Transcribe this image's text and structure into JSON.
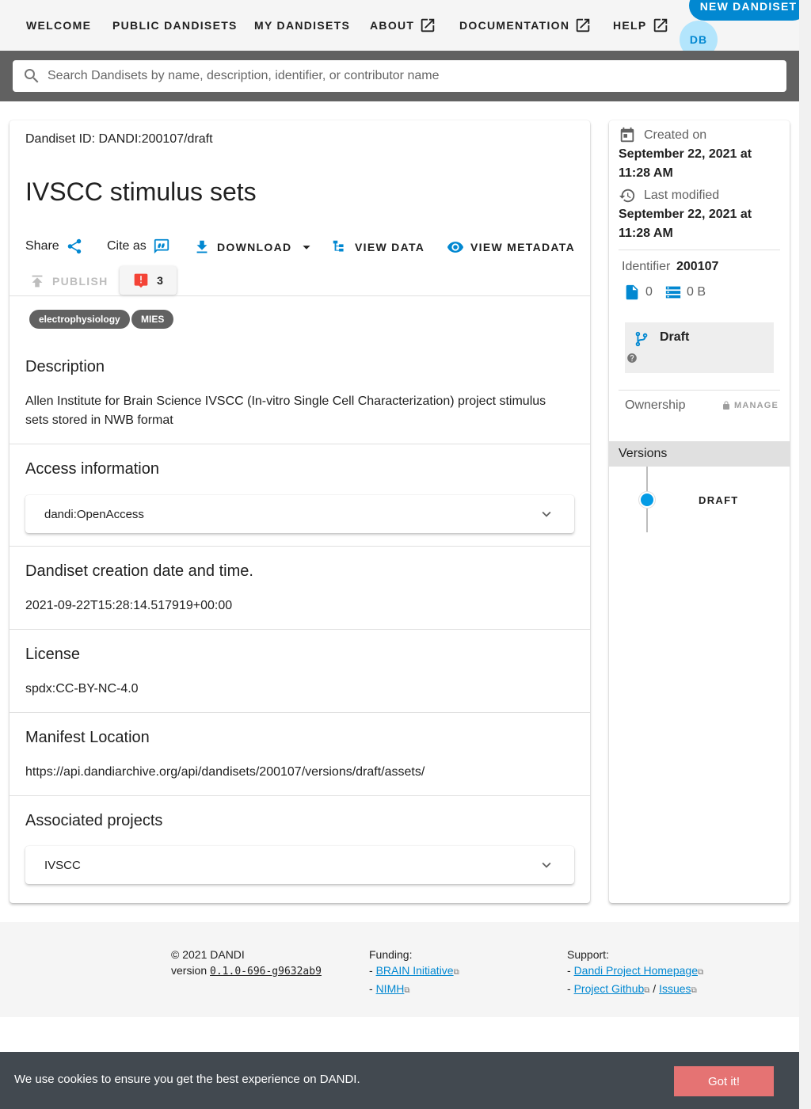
{
  "nav": {
    "items": [
      {
        "label": "Welcome",
        "external": false
      },
      {
        "label": "Public Dandisets",
        "external": false
      },
      {
        "label": "My Dandisets",
        "external": false
      },
      {
        "label": "About",
        "external": true
      },
      {
        "label": "Documentation",
        "external": true
      },
      {
        "label": "Help",
        "external": true
      }
    ],
    "new_dandiset_label": "New Dandiset",
    "avatar_initials": "DB"
  },
  "search": {
    "placeholder": "Search Dandisets by name, description, identifier, or contributor name",
    "value": ""
  },
  "dandiset": {
    "id_line": "Dandiset ID: DANDI:200107/draft",
    "title": "IVSCC stimulus sets",
    "actions": {
      "share": "Share",
      "cite": "Cite as",
      "download": "Download",
      "view_data": "View Data",
      "view_metadata": "View Metadata",
      "publish": "Publish",
      "error_count": "3"
    },
    "keywords": [
      "electrophysiology",
      "MIES"
    ],
    "sections": {
      "description_title": "Description",
      "description_text": "Allen Institute for Brain Science IVSCC (In-vitro Single Cell Characterization) project stimulus sets stored in NWB format",
      "access_title": "Access information",
      "access_value": "dandi:OpenAccess",
      "created_title": "Dandiset creation date and time.",
      "created_value": "2021-09-22T15:28:14.517919+00:00",
      "license_title": "License",
      "license_value": "spdx:CC-BY-NC-4.0",
      "manifest_title": "Manifest Location",
      "manifest_value": "https://api.dandiarchive.org/api/dandisets/200107/versions/draft/assets/",
      "projects_title": "Associated projects",
      "projects_value": "IVSCC"
    }
  },
  "sidebar": {
    "created_label": "Created on",
    "created_value": "September 22, 2021 at 11:28 AM",
    "modified_label": "Last modified",
    "modified_value": "September 22, 2021 at 11:28 AM",
    "identifier_label": "Identifier",
    "identifier_value": "200107",
    "file_count": "0",
    "size": "0 B",
    "status": "Draft",
    "ownership_label": "Ownership",
    "manage_label": "Manage",
    "versions_label": "Versions",
    "versions": [
      "Draft"
    ]
  },
  "footer": {
    "copyright": "© 2021 DANDI",
    "version_prefix": "version ",
    "version": "0.1.0-696-g9632ab9",
    "funding_label": "Funding:",
    "funding_links": [
      "BRAIN Initiative",
      "NIMH"
    ],
    "support_label": "Support:",
    "support_homepage": "Dandi Project Homepage",
    "support_github": "Project Github",
    "support_issues": "Issues"
  },
  "cookie": {
    "text": "We use cookies to ensure you get the best experience on DANDI.",
    "button": "Got it!"
  },
  "colors": {
    "accent": "#0288d1",
    "error": "#f44336",
    "chip": "#616161",
    "cookie_bg": "#424950",
    "cookie_button": "#e57373"
  }
}
